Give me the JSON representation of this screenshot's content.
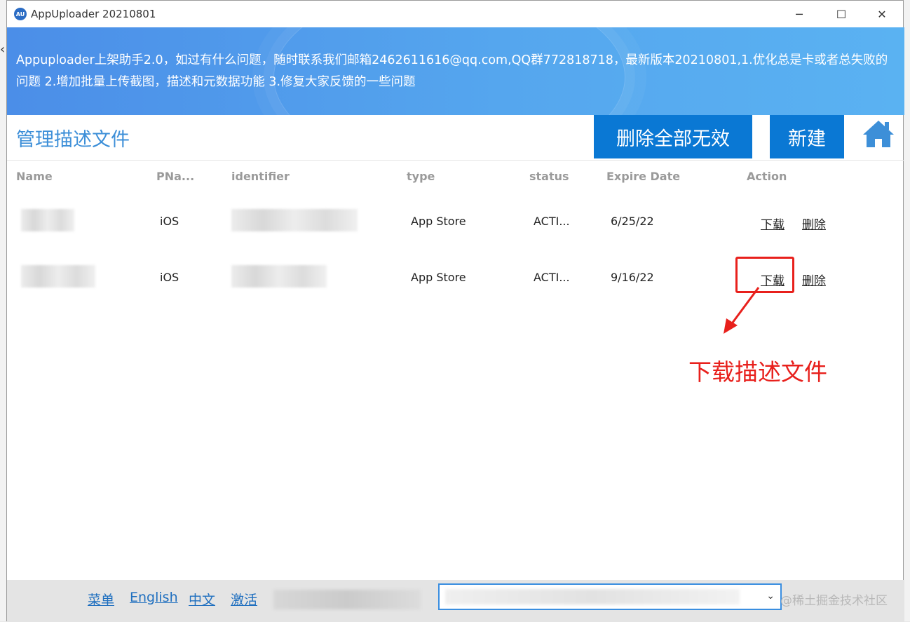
{
  "window": {
    "title": "AppUploader 20210801",
    "icon_text": "AU",
    "controls": [
      "─",
      "☐",
      "✕"
    ]
  },
  "banner": {
    "text": "Appuploader上架助手2.0，如过有什么问题，随时联系我们邮箱2462611616@qq.com,QQ群772818718，最新版本20210801,1.优化总是卡或者总失败的问题 2.增加批量上传截图，描述和元数据功能 3.修复大家反馈的一些问题"
  },
  "header": {
    "title": "管理描述文件",
    "delete_invalid_label": "删除全部无效",
    "new_label": "新建",
    "home_icon": "home-icon"
  },
  "table": {
    "columns": [
      "Name",
      "PNa...",
      "identifier",
      "type",
      "status",
      "Expire Date",
      "Action"
    ],
    "rows": [
      {
        "platform": "iOS",
        "type": "App Store",
        "status": "ACTI...",
        "expire": "6/25/22",
        "download": "下载",
        "delete": "删除"
      },
      {
        "platform": "iOS",
        "type": "App Store",
        "status": "ACTI...",
        "expire": "9/16/22",
        "download": "下载",
        "delete": "删除"
      }
    ]
  },
  "annotation": {
    "text": "下载描述文件",
    "color": "#e8201c"
  },
  "footer": {
    "links": [
      "菜单",
      "English",
      "中文",
      "激活"
    ],
    "watermark": "@稀土掘金技术社区"
  },
  "colors": {
    "accent": "#0a78d4",
    "banner": "#4b8ee8",
    "title": "#3d8fd8",
    "link": "#1f6fbf"
  }
}
